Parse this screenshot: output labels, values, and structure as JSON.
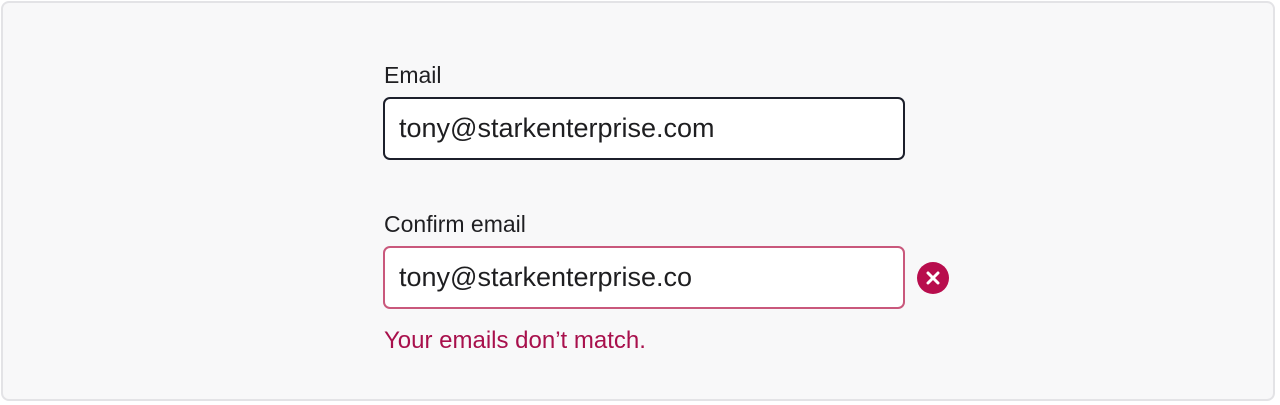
{
  "email": {
    "label": "Email",
    "value": "tony@starkenterprise.com"
  },
  "confirm_email": {
    "label": "Confirm email",
    "value": "tony@starkenterprise.co",
    "error_icon": "error-circle-x-icon",
    "error_message": "Your emails don’t match."
  },
  "colors": {
    "error": "#b80d4d",
    "error_border": "#c9587c",
    "input_border": "#1c1f2b",
    "panel_bg": "#f8f8f9"
  }
}
